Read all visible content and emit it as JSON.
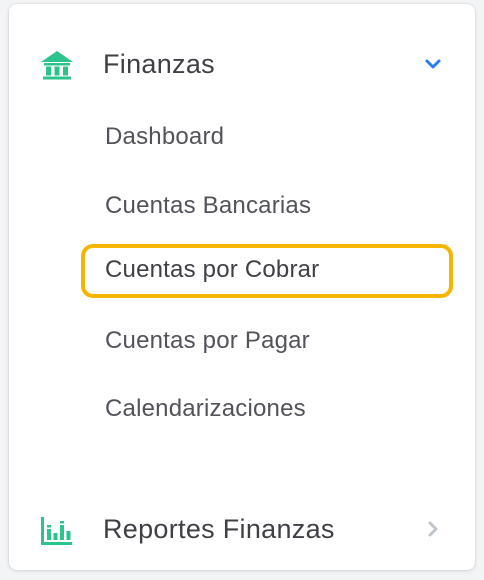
{
  "sidebar": {
    "finance_section": {
      "label": "Finanzas",
      "icon": "bank-icon",
      "icon_color": "#2bc48a",
      "expanded": true,
      "chevron": "chevron-down-icon",
      "chevron_color": "#2b7de9",
      "items": [
        {
          "label": "Dashboard",
          "active": false
        },
        {
          "label": "Cuentas Bancarias",
          "active": false
        },
        {
          "label": "Cuentas por Cobrar",
          "active": true
        },
        {
          "label": "Cuentas por Pagar",
          "active": false
        },
        {
          "label": "Calendarizaciones",
          "active": false
        }
      ]
    },
    "reports_section": {
      "label": "Reportes Finanzas",
      "icon": "bar-chart-icon",
      "icon_color": "#2bc48a",
      "expanded": false,
      "chevron": "chevron-right-icon",
      "chevron_color": "#c0c4cc"
    },
    "active_highlight_color": "#f5b500"
  }
}
